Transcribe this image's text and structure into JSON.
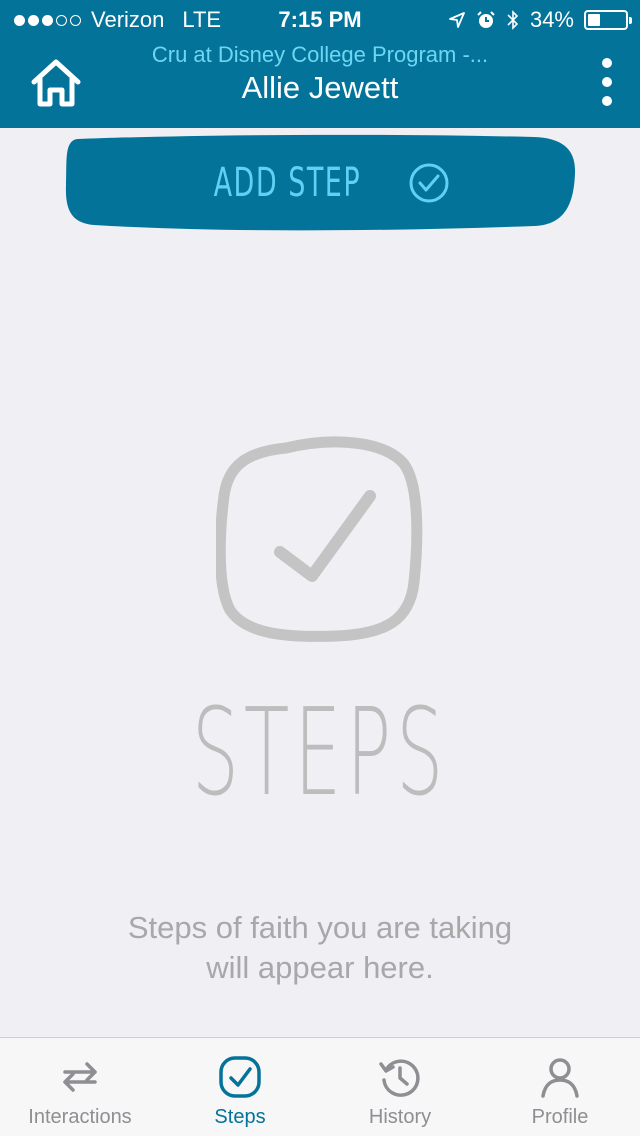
{
  "status_bar": {
    "carrier": "Verizon",
    "network": "LTE",
    "time": "7:15 PM",
    "battery": "34%",
    "battery_level": 0.34
  },
  "header": {
    "subtitle": "Cru at Disney College Program -...",
    "title": "Allie Jewett",
    "home_icon": "home-icon",
    "more_icon": "more-vertical-icon"
  },
  "add_step": {
    "label": "ADD STEP",
    "icon": "check-circle-icon"
  },
  "empty_state": {
    "icon": "checkbox-check-icon",
    "title": "STEPS",
    "description": "Steps of faith you are taking will appear here."
  },
  "tabs": [
    {
      "label": "Interactions",
      "icon": "swap-arrows-icon",
      "active": false
    },
    {
      "label": "Steps",
      "icon": "check-square-icon",
      "active": true
    },
    {
      "label": "History",
      "icon": "history-icon",
      "active": false
    },
    {
      "label": "Profile",
      "icon": "person-icon",
      "active": false
    }
  ],
  "colors": {
    "primary": "#03739a",
    "accent": "#5fd2f4",
    "background": "#efeff4",
    "muted": "#bdbdbd"
  }
}
